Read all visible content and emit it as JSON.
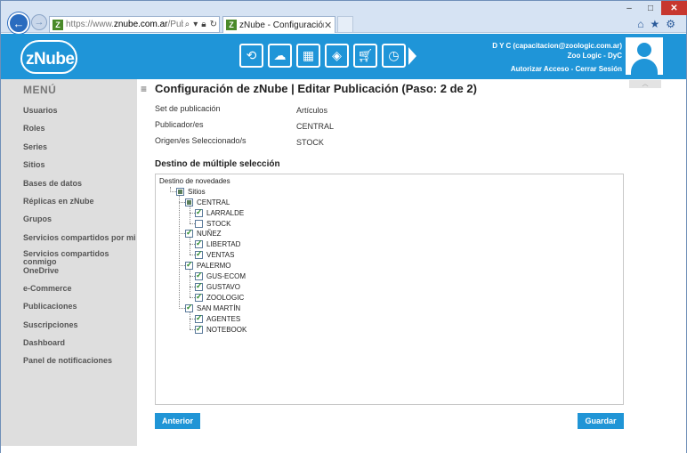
{
  "browser": {
    "address_prefix": "https://www.",
    "address_domain": "znube.com.ar",
    "address_path": "/Publication...",
    "tab_title": "zNube - Configuración de z...",
    "favicon": "Z",
    "window_controls": {
      "minimize": "–",
      "maximize": "□",
      "close": "✕"
    },
    "icons": [
      "home-icon",
      "star-icon",
      "gear-icon"
    ]
  },
  "header": {
    "logo_text": "zNube",
    "user_line1": "D Y C (capacitacion@zoologic.com.ar)",
    "user_line2": "Zoo Logic - DyC",
    "authorize": "Autorizar Acceso",
    "separator": "-",
    "logout": "Cerrar Sesión",
    "tools": [
      "sync-icon",
      "cloud-icon",
      "grid-icon",
      "cube-icon",
      "cart-icon",
      "clock-icon"
    ],
    "accent": "#1f95d8"
  },
  "sidebar": {
    "title": "MENÚ",
    "items": [
      {
        "label": "Usuarios"
      },
      {
        "label": "Roles"
      },
      {
        "label": "Series"
      },
      {
        "label": "Sitios"
      },
      {
        "label": "Bases de datos"
      },
      {
        "label": "Réplicas en zNube"
      },
      {
        "label": "Grupos"
      },
      {
        "label": "Servicios compartidos por mi"
      },
      {
        "label": "Servicios compartidos conmigo"
      },
      {
        "label": "OneDrive"
      },
      {
        "label": "e-Commerce"
      },
      {
        "label": "Publicaciones"
      },
      {
        "label": "Suscripciones"
      },
      {
        "label": "Dashboard"
      },
      {
        "label": "Panel de notificaciones"
      }
    ]
  },
  "main": {
    "title": "Configuración de zNube | Editar Publicación (Paso: 2 de 2)",
    "fields": [
      {
        "label": "Set de publicación",
        "value": "Artículos"
      },
      {
        "label": "Publicador/es",
        "value": "CENTRAL"
      },
      {
        "label": "Origen/es Seleccionado/s",
        "value": "STOCK"
      }
    ],
    "section_title": "Destino de múltiple selección",
    "tree": {
      "root": "Destino de novedades",
      "sitios": "Sitios",
      "groups": [
        {
          "name": "CENTRAL",
          "state": "partial",
          "children": [
            {
              "name": "LARRALDE",
              "checked": true
            },
            {
              "name": "STOCK",
              "checked": false
            }
          ]
        },
        {
          "name": "NUÑEZ",
          "state": "checked",
          "children": [
            {
              "name": "LIBERTAD",
              "checked": true
            },
            {
              "name": "VENTAS",
              "checked": true
            }
          ]
        },
        {
          "name": "PALERMO",
          "state": "checked",
          "children": [
            {
              "name": "GUS-ECOM",
              "checked": true
            },
            {
              "name": "GUSTAVO",
              "checked": true
            },
            {
              "name": "ZOOLOGIC",
              "checked": true
            }
          ]
        },
        {
          "name": "SAN MARTÍN",
          "state": "checked",
          "children": [
            {
              "name": "AGENTES",
              "checked": true
            },
            {
              "name": "NOTEBOOK",
              "checked": true
            }
          ]
        }
      ]
    },
    "buttons": {
      "previous": "Anterior",
      "save": "Guardar"
    }
  }
}
